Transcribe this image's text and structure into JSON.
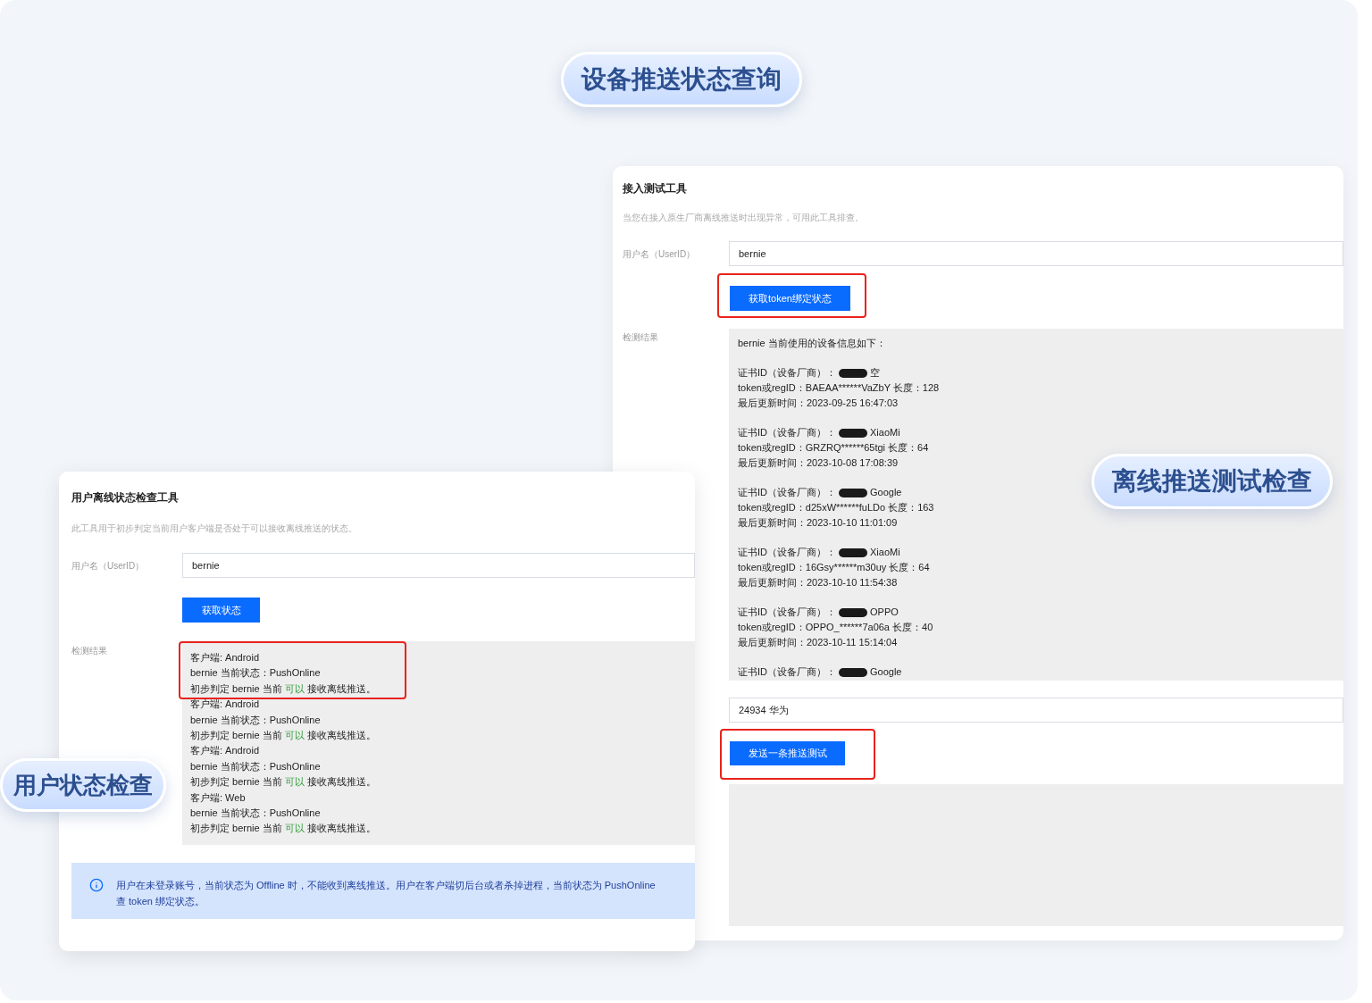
{
  "callouts": [
    {
      "text": "设备推送状态查询"
    },
    {
      "text": "离线推送测试检查"
    },
    {
      "text": "用户状态检查"
    }
  ],
  "access_tool": {
    "title": "接入测试工具",
    "description": "当您在接入原生厂商离线推送时出现异常，可用此工具排查。",
    "user_label": "用户名（UserID）",
    "user_value": "bernie",
    "button": "获取token绑定状态",
    "result_label": "检测结果",
    "result_header": "bernie 当前使用的设备信息如下：",
    "devices": [
      {
        "cert_label": "证书ID（设备厂商）：",
        "vendor": "空",
        "token": "token或regID：BAEAA******VaZbY 长度：128",
        "updated": "最后更新时间：2023-09-25 16:47:03"
      },
      {
        "cert_label": "证书ID（设备厂商）：",
        "vendor": "XiaoMi",
        "token": "token或regID：GRZRQ******65tgi 长度：64",
        "updated": "最后更新时间：2023-10-08 17:08:39"
      },
      {
        "cert_label": "证书ID（设备厂商）：",
        "vendor": "Google",
        "token": "token或regID：d25xW******fuLDo 长度：163",
        "updated": "最后更新时间：2023-10-10 11:01:09"
      },
      {
        "cert_label": "证书ID（设备厂商）：",
        "vendor": "XiaoMi",
        "token": "token或regID：16Gsy******m30uy 长度：64",
        "updated": "最后更新时间：2023-10-10 11:54:38"
      },
      {
        "cert_label": "证书ID（设备厂商）：",
        "vendor": "OPPO",
        "token": "token或regID：OPPO_******7a06a 长度：40",
        "updated": "最后更新时间：2023-10-11 15:14:04"
      },
      {
        "cert_label": "证书ID（设备厂商）：",
        "vendor": "Google"
      }
    ],
    "device_value": "24934 华为",
    "send_button": "发送一条推送测试"
  },
  "user_tool": {
    "title": "用户离线状态检查工具",
    "description": "此工具用于初步判定当前用户客户端是否处于可以接收离线推送的状态。",
    "user_label": "用户名（UserID）",
    "user_value": "bernie",
    "button": "获取状态",
    "result_label": "检测结果",
    "clients": [
      {
        "client": "客户端: Android",
        "state": "bernie 当前状态：PushOnline",
        "verdict_before": "初步判定 bernie 当前",
        "verdict_highlight": "可以",
        "verdict_after": "接收离线推送。"
      },
      {
        "client": "客户端: Android",
        "state": "bernie 当前状态：PushOnline",
        "verdict_before": "初步判定 bernie 当前",
        "verdict_highlight": "可以",
        "verdict_after": "接收离线推送。"
      },
      {
        "client": "客户端: Android",
        "state": "bernie 当前状态：PushOnline",
        "verdict_before": "初步判定 bernie 当前",
        "verdict_highlight": "可以",
        "verdict_after": "接收离线推送。"
      },
      {
        "client": "客户端: Web",
        "state": "bernie 当前状态：PushOnline",
        "verdict_before": "初步判定 bernie 当前",
        "verdict_highlight": "可以",
        "verdict_after": "接收离线推送。"
      }
    ],
    "notice": "用户在未登录账号，当前状态为 Offline 时，不能收到离线推送。用户在客户端切后台或者杀掉进程，当前状态为 PushOnline",
    "notice_line2": "查 token 绑定状态。"
  }
}
